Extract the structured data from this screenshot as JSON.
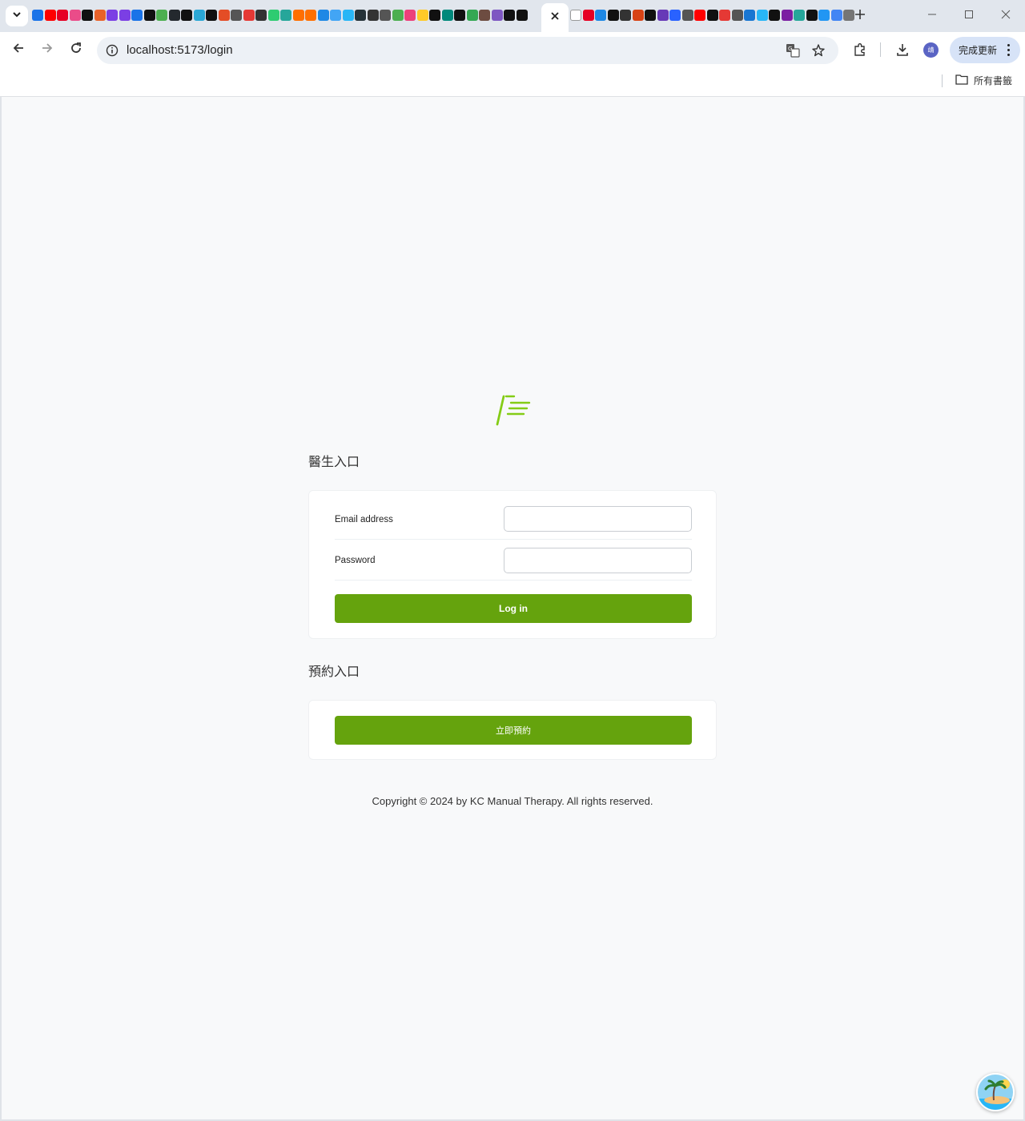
{
  "browser": {
    "url": "localhost:5173/login",
    "update_button_label": "完成更新",
    "avatar_initial": "靖",
    "bookmarks_all_label": "所有書籤",
    "favicon_colors_left": [
      "#1a73e8",
      "#ff0000",
      "#e60023",
      "#ea4c89",
      "#111111",
      "#e9622a",
      "#7b3fe4",
      "#7b3fe4",
      "#1a73e8",
      "#111111",
      "#4caf50",
      "#24292e",
      "#111111",
      "#2aa7d5",
      "#111111",
      "#e44d26",
      "#555555",
      "#e53935",
      "#333333",
      "#2ecc71",
      "#26a69a",
      "#ff6f00",
      "#ff6f00",
      "#1e88e5",
      "#42a5f5",
      "#29b6f6",
      "#263238",
      "#333333",
      "#555555",
      "#4caf50",
      "#ec407a",
      "#ffca28",
      "#111111",
      "#00897b",
      "#111111",
      "#34a853",
      "#6d4c41",
      "#7e57c2",
      "#111111",
      "#111111"
    ],
    "favicon_colors_right": [
      "#ffffff",
      "#e60023",
      "#1e88e5",
      "#111111",
      "#333333",
      "#d84315",
      "#111111",
      "#673ab7",
      "#2962ff",
      "#555555",
      "#ff0000",
      "#111111",
      "#e53935",
      "#555555",
      "#1976d2",
      "#29b6f6",
      "#111111",
      "#7b1fa2",
      "#26a69a",
      "#111111",
      "#2196f3",
      "#4285f4",
      "#757575"
    ]
  },
  "page": {
    "doctor_section_title": "醫生入口",
    "email_label": "Email address",
    "email_value": "",
    "password_label": "Password",
    "password_value": "",
    "login_button_label": "Log in",
    "booking_section_title": "預約入口",
    "booking_button_label": "立即預約",
    "copyright": "Copyright © 2024 by KC Manual Therapy. All rights reserved."
  },
  "colors": {
    "accent": "#65a30d",
    "logo": "#84cc16",
    "page_background": "#f8f9fa"
  }
}
